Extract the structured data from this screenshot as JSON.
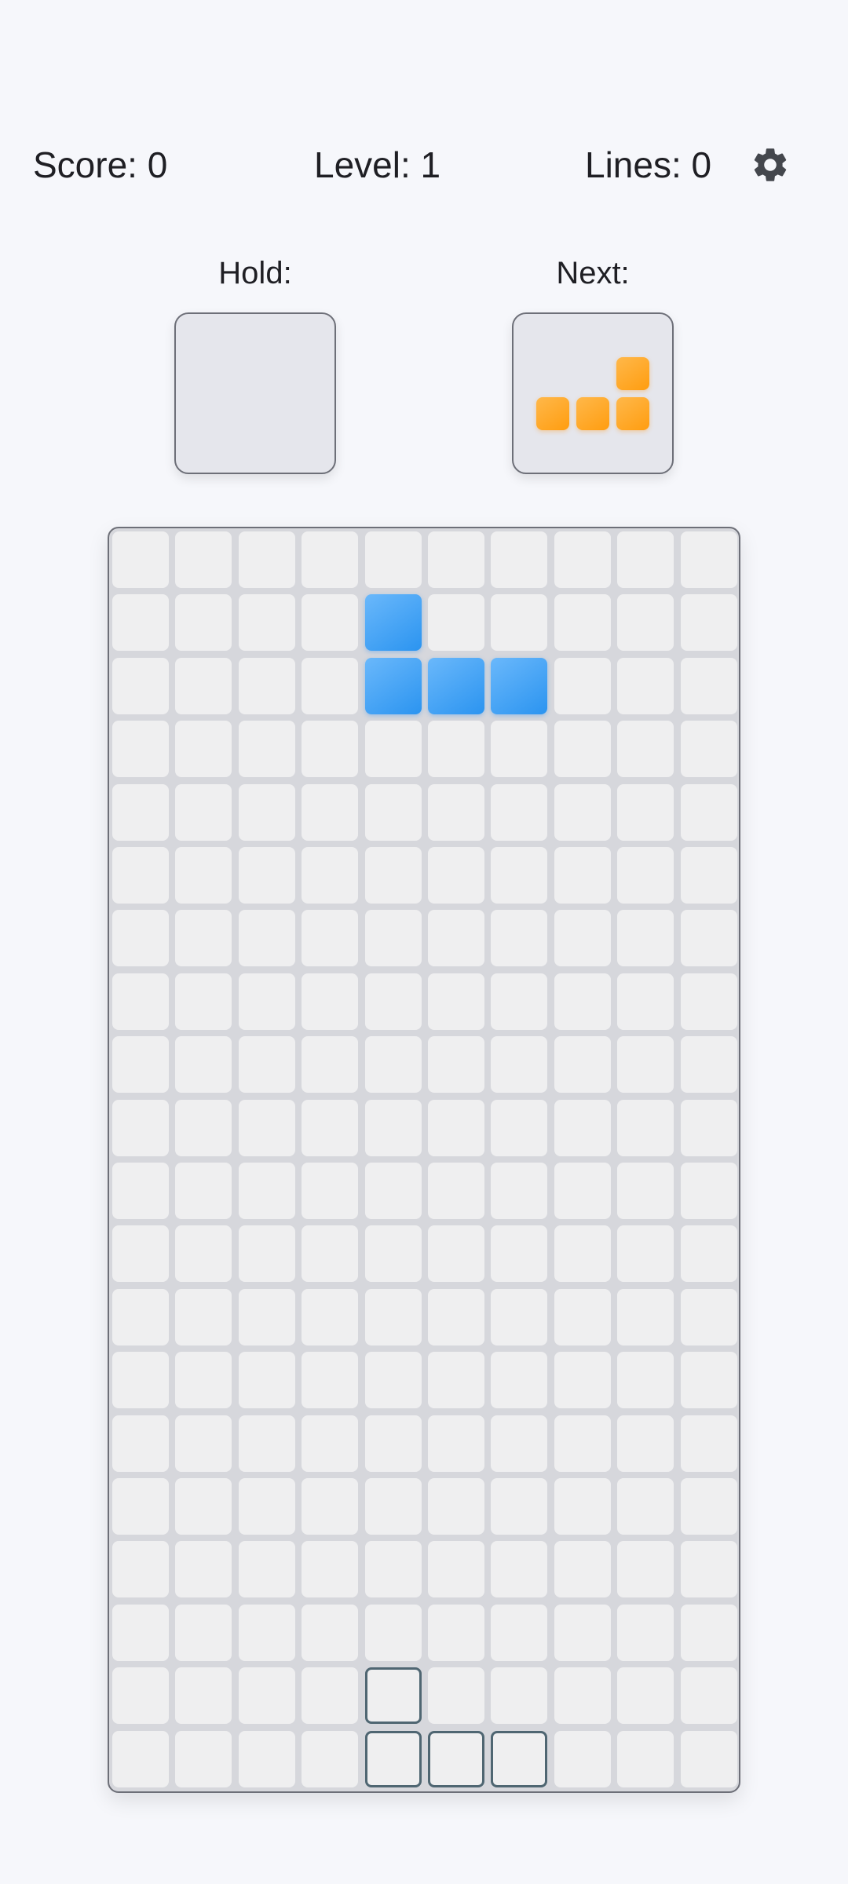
{
  "stats": {
    "score_label": "Score: 0",
    "level_label": "Level: 1",
    "lines_label": "Lines: 0"
  },
  "settings": {
    "icon": "gear-icon",
    "color": "#44474d"
  },
  "hold": {
    "label": "Hold:",
    "piece": null
  },
  "next": {
    "label": "Next:",
    "piece": "L",
    "color": "#ffa21c",
    "cells": [
      [
        2,
        0
      ],
      [
        0,
        1
      ],
      [
        1,
        1
      ],
      [
        2,
        1
      ]
    ]
  },
  "board": {
    "columns": 10,
    "rows": 20,
    "active_piece": {
      "type": "J",
      "color": "#3d9ff5",
      "cells": [
        [
          4,
          1
        ],
        [
          4,
          2
        ],
        [
          5,
          2
        ],
        [
          6,
          2
        ]
      ]
    },
    "ghost_piece": {
      "outline_color": "#4f6672",
      "cells": [
        [
          4,
          18
        ],
        [
          4,
          19
        ],
        [
          5,
          19
        ],
        [
          6,
          19
        ]
      ]
    }
  }
}
